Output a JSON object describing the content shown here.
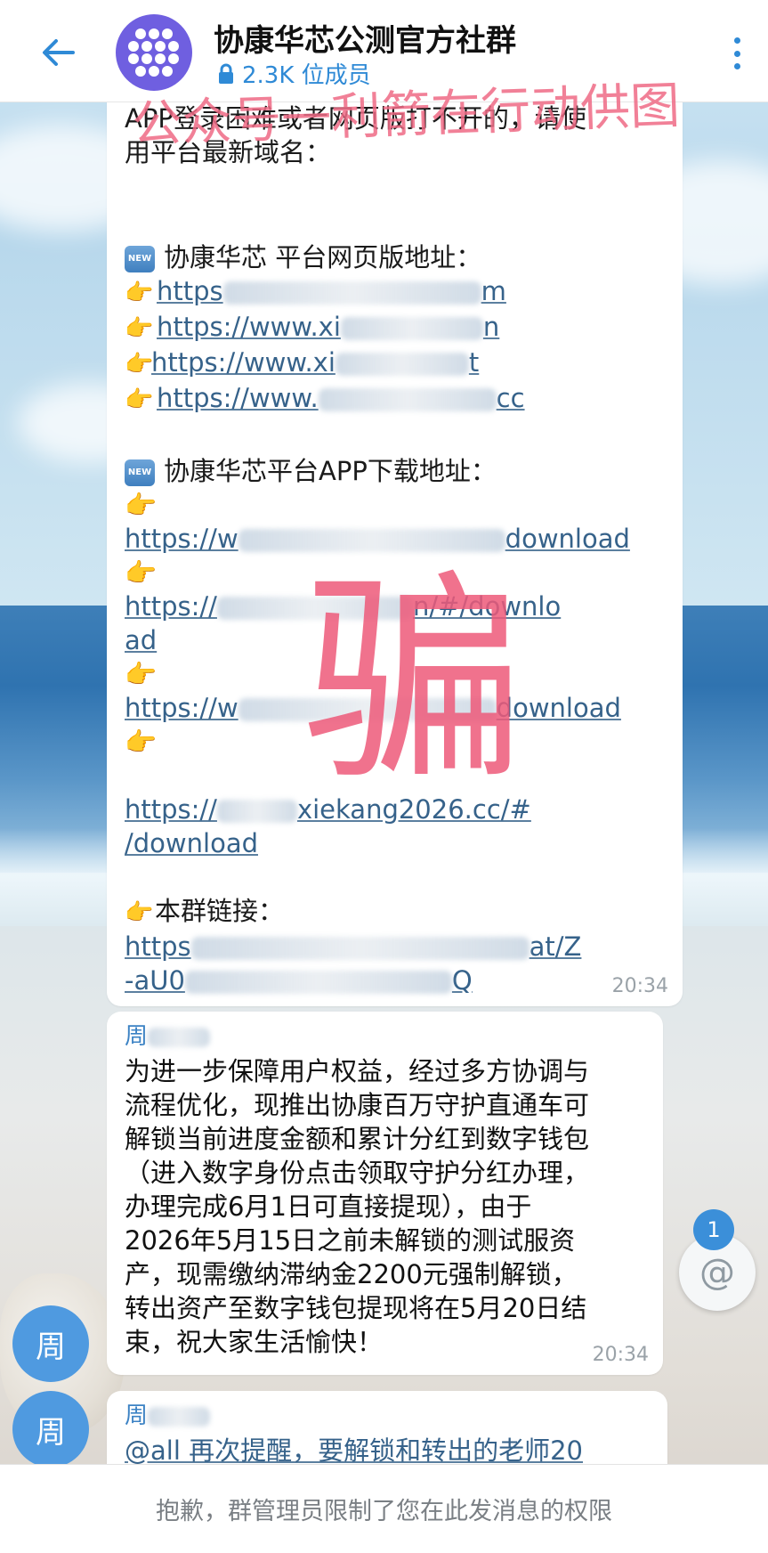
{
  "header": {
    "title": "协康华芯公测官方社群",
    "members": "2.3K 位成员"
  },
  "watermark": {
    "top": "公众号一利箭在行动供图",
    "big": "骗"
  },
  "message1": {
    "intro": [
      "APP登录困难或者网页版打不开的，请使",
      "用平台最新域名："
    ],
    "web_heading": "协康华芯 平台网页版地址：",
    "web_links": [
      {
        "pre": "https",
        "post": "m"
      },
      {
        "pre": "https://www.xi",
        "post": "n"
      },
      {
        "pre": "https://www.xi",
        "post": "t"
      },
      {
        "pre": "https://www.",
        "post": "cc"
      }
    ],
    "app_heading": "协康华芯平台APP下载地址：",
    "app_links": [
      [
        "https://w",
        "download"
      ],
      [
        "https://",
        "n/#/downlo",
        "ad"
      ],
      [
        "https://w",
        "download"
      ],
      [
        "https://",
        "xiekang2026.cc/#",
        "/download"
      ]
    ],
    "group_link_label": "本群链接：",
    "group_link": [
      "https",
      "at/Z",
      "-aU0",
      "Q"
    ],
    "new_badge": "NEW",
    "time": "20:34"
  },
  "message2": {
    "sender": "周",
    "lines": [
      "为进一步保障用户权益，经过多方协调与",
      "流程优化，现推出协康百万守护直通车可",
      "解锁当前进度金额和累计分红到数字钱包",
      "（进入数字身份点击领取守护分红办理，",
      "办理完成6月1日可直接提现），由于",
      "2026年5月15日之前未解锁的测试服资",
      "产，现需缴纳滞纳金2200元强制解锁，",
      "转出资产至数字钱包提现将在5月20日结",
      "束，祝大家生活愉快！"
    ],
    "time": "20:34"
  },
  "message3": {
    "sender": "周",
    "text": "@all 再次提醒，要解锁和转出的老师20"
  },
  "side_avatars": [
    "周",
    "周"
  ],
  "mention": {
    "count": "1",
    "icon": "@"
  },
  "bottom_notice": "抱歉，群管理员限制了您在此发消息的权限"
}
